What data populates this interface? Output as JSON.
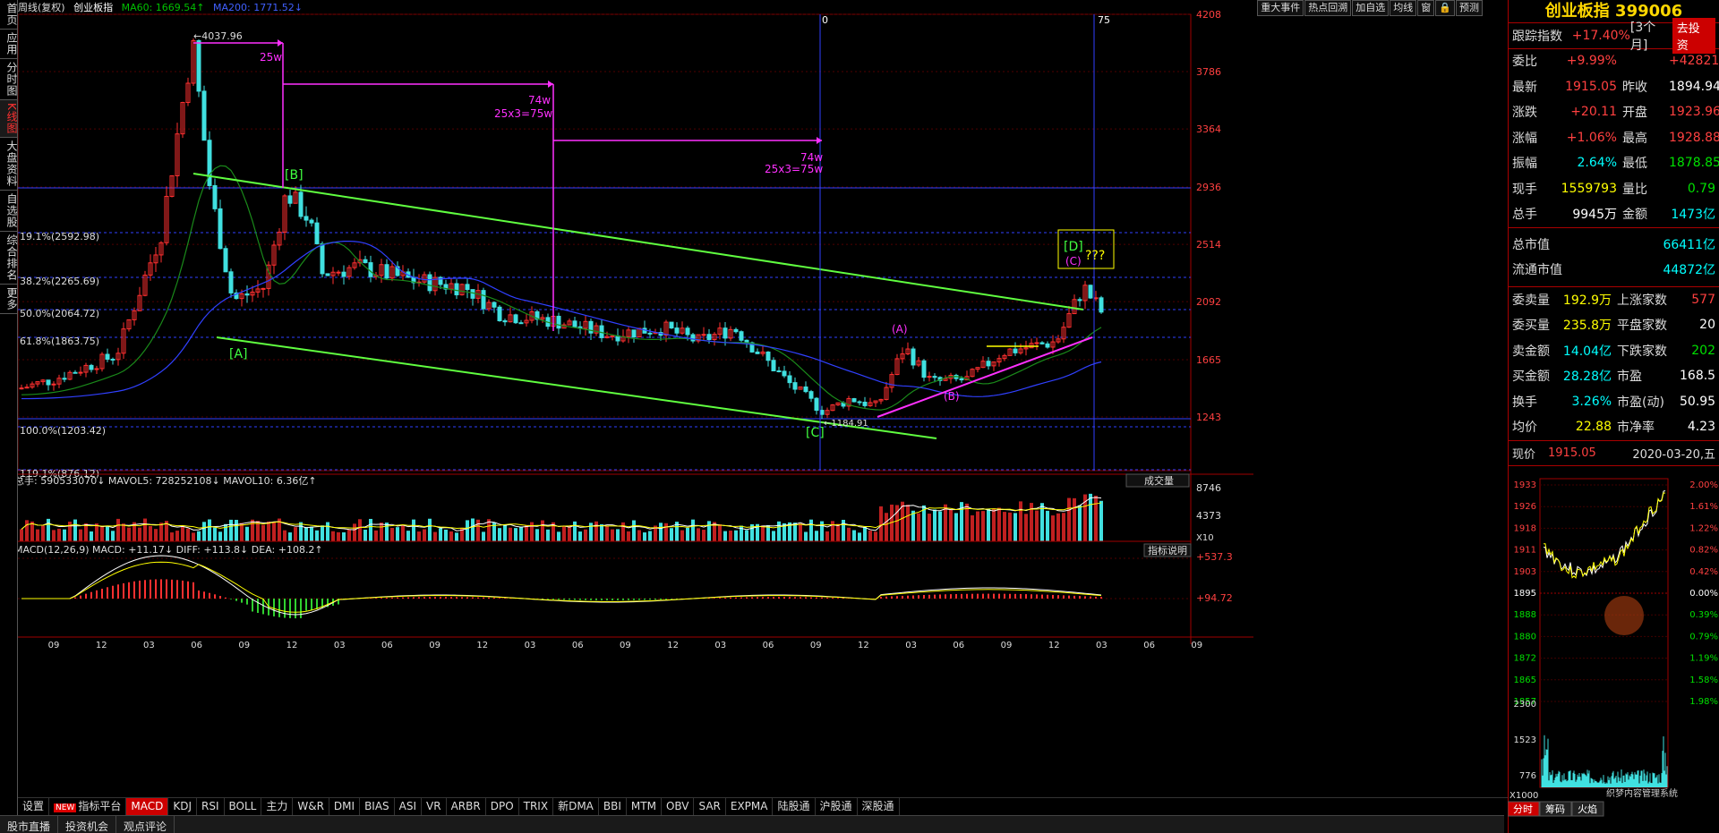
{
  "sidebar": {
    "tabs": [
      {
        "label": "首页",
        "active": false
      },
      {
        "label": "应用",
        "active": false
      },
      {
        "label": "分时图",
        "active": false
      },
      {
        "label": "K线图",
        "active": true
      },
      {
        "label": "大盘资料",
        "active": false
      },
      {
        "label": "自选股",
        "active": false
      },
      {
        "label": "综合排名",
        "active": false
      },
      {
        "label": "更多",
        "active": false
      }
    ]
  },
  "chart_header": {
    "period": "周线(复权)",
    "name": "创业板指",
    "ma60": "MA60: 1669.54↑",
    "ma200": "MA200: 1771.52↓"
  },
  "toolbar": {
    "buttons": [
      "重大事件",
      "热点回溯",
      "加自选",
      "均线",
      "窗",
      "预测"
    ]
  },
  "price_axis": [
    "4208",
    "3786",
    "3364",
    "2936",
    "2514",
    "2092",
    "1665",
    "1243"
  ],
  "fib_levels": [
    "19.1%(2592.98)",
    "38.2%(2265.69)",
    "50.0%(2064.72)",
    "61.8%(1863.75)",
    "100.0%(1203.42)",
    "119.1%(876.12)"
  ],
  "annotations": {
    "high": "4037.96",
    "low": "1184.91",
    "A": "[A]",
    "B": "[B]",
    "C": "[C]",
    "D": "[D]",
    "a": "(A)",
    "b": "(B)",
    "c": "(C)",
    "q": "???",
    "t25": "25w",
    "t74a": "74w",
    "t75a": "25x3=75w",
    "t74b": "74w",
    "t75b": "25x3=75w",
    "v0": "0",
    "v75": "75"
  },
  "volume": {
    "header": "总手: 590533070↓ MAVOL5: 728252108↓ MAVOL10: 6.36亿↑",
    "selector": "成交量",
    "axis": [
      "8746",
      "4373",
      "X10"
    ]
  },
  "macd": {
    "header": "MACD(12,26,9) MACD: +11.17↓ DIFF: +113.8↓ DEA: +108.2↑",
    "button": "指标说明",
    "axis": [
      "+537.3",
      "+94.72"
    ]
  },
  "x_axis": [
    "09",
    "12",
    "03",
    "06",
    "09",
    "12",
    "03",
    "06",
    "09",
    "12",
    "03",
    "06",
    "09",
    "12",
    "03",
    "06",
    "09",
    "12",
    "03",
    "06",
    "09",
    "12",
    "03",
    "06",
    "09"
  ],
  "bottom_tabs": {
    "settings": "设置",
    "new_badge": "NEW",
    "items": [
      "指标平台",
      "MACD",
      "KDJ",
      "RSI",
      "BOLL",
      "主力",
      "W&R",
      "DMI",
      "BIAS",
      "ASI",
      "VR",
      "ARBR",
      "DPO",
      "TRIX",
      "新DMA",
      "BBI",
      "MTM",
      "OBV",
      "SAR",
      "EXPMA",
      "陆股通",
      "沪股通",
      "深股通"
    ],
    "active": "MACD"
  },
  "status_bar": [
    "股市直播",
    "投资机会",
    "观点评论"
  ],
  "panel": {
    "title": "创业板指 399006",
    "track": {
      "label": "跟踪指数",
      "value": "+17.40%",
      "period": "[3个月]",
      "button": "去投资"
    },
    "rows1": [
      {
        "k": "委比",
        "v": "+9.99%",
        "vc": "red",
        "k2": "",
        "v2": "+428216",
        "v2c": "red"
      },
      {
        "k": "最新",
        "v": "1915.05",
        "vc": "red",
        "k2": "昨收",
        "v2": "1894.94",
        "v2c": "white"
      },
      {
        "k": "涨跌",
        "v": "+20.11",
        "vc": "red",
        "k2": "开盘",
        "v2": "1923.96",
        "v2c": "red"
      },
      {
        "k": "涨幅",
        "v": "+1.06%",
        "vc": "red",
        "k2": "最高",
        "v2": "1928.88",
        "v2c": "red"
      },
      {
        "k": "振幅",
        "v": "2.64%",
        "vc": "cyan",
        "k2": "最低",
        "v2": "1878.85",
        "v2c": "green"
      },
      {
        "k": "现手",
        "v": "1559793",
        "vc": "yellow",
        "k2": "量比",
        "v2": "0.79",
        "v2c": "green"
      },
      {
        "k": "总手",
        "v": "9945万",
        "vc": "white",
        "k2": "金额",
        "v2": "1473亿",
        "v2c": "cyan"
      }
    ],
    "rows2": [
      {
        "k": "总市值",
        "v": "66411亿",
        "vc": "cyan"
      },
      {
        "k": "流通市值",
        "v": "44872亿",
        "vc": "cyan"
      }
    ],
    "rows3": [
      {
        "k": "委卖量",
        "v": "192.9万",
        "vc": "yellow",
        "k2": "上涨家数",
        "v2": "577",
        "v2c": "red"
      },
      {
        "k": "委买量",
        "v": "235.8万",
        "vc": "yellow",
        "k2": "平盘家数",
        "v2": "20",
        "v2c": "white"
      },
      {
        "k": "卖金额",
        "v": "14.04亿",
        "vc": "cyan",
        "k2": "下跌家数",
        "v2": "202",
        "v2c": "green"
      },
      {
        "k": "买金额",
        "v": "28.28亿",
        "vc": "cyan",
        "k2": "市盈",
        "v2": "168.5",
        "v2c": "white"
      },
      {
        "k": "换手",
        "v": "3.26%",
        "vc": "cyan",
        "k2": "市盈(动)",
        "v2": "50.95",
        "v2c": "white"
      },
      {
        "k": "均价",
        "v": "22.88",
        "vc": "yellow",
        "k2": "市净率",
        "v2": "4.23",
        "v2c": "white"
      }
    ],
    "now": {
      "label": "现价",
      "price": "1915.05",
      "date": "2020-03-20,五"
    },
    "mini_left": [
      "1933",
      "1926",
      "1918",
      "1911",
      "1903",
      "1895",
      "1888",
      "1880",
      "1872",
      "1865",
      "1857",
      "2300",
      "1523",
      "776"
    ],
    "mini_right": [
      "2.00%",
      "1.61%",
      "1.22%",
      "0.82%",
      "0.42%",
      "0.00%",
      "0.39%",
      "0.79%",
      "1.19%",
      "1.58%",
      "1.98%"
    ],
    "mini_unit": "X1000",
    "mini_tabs": [
      "分时",
      "筹码",
      "火焰"
    ]
  },
  "watermark": "织梦内容管理系统"
}
